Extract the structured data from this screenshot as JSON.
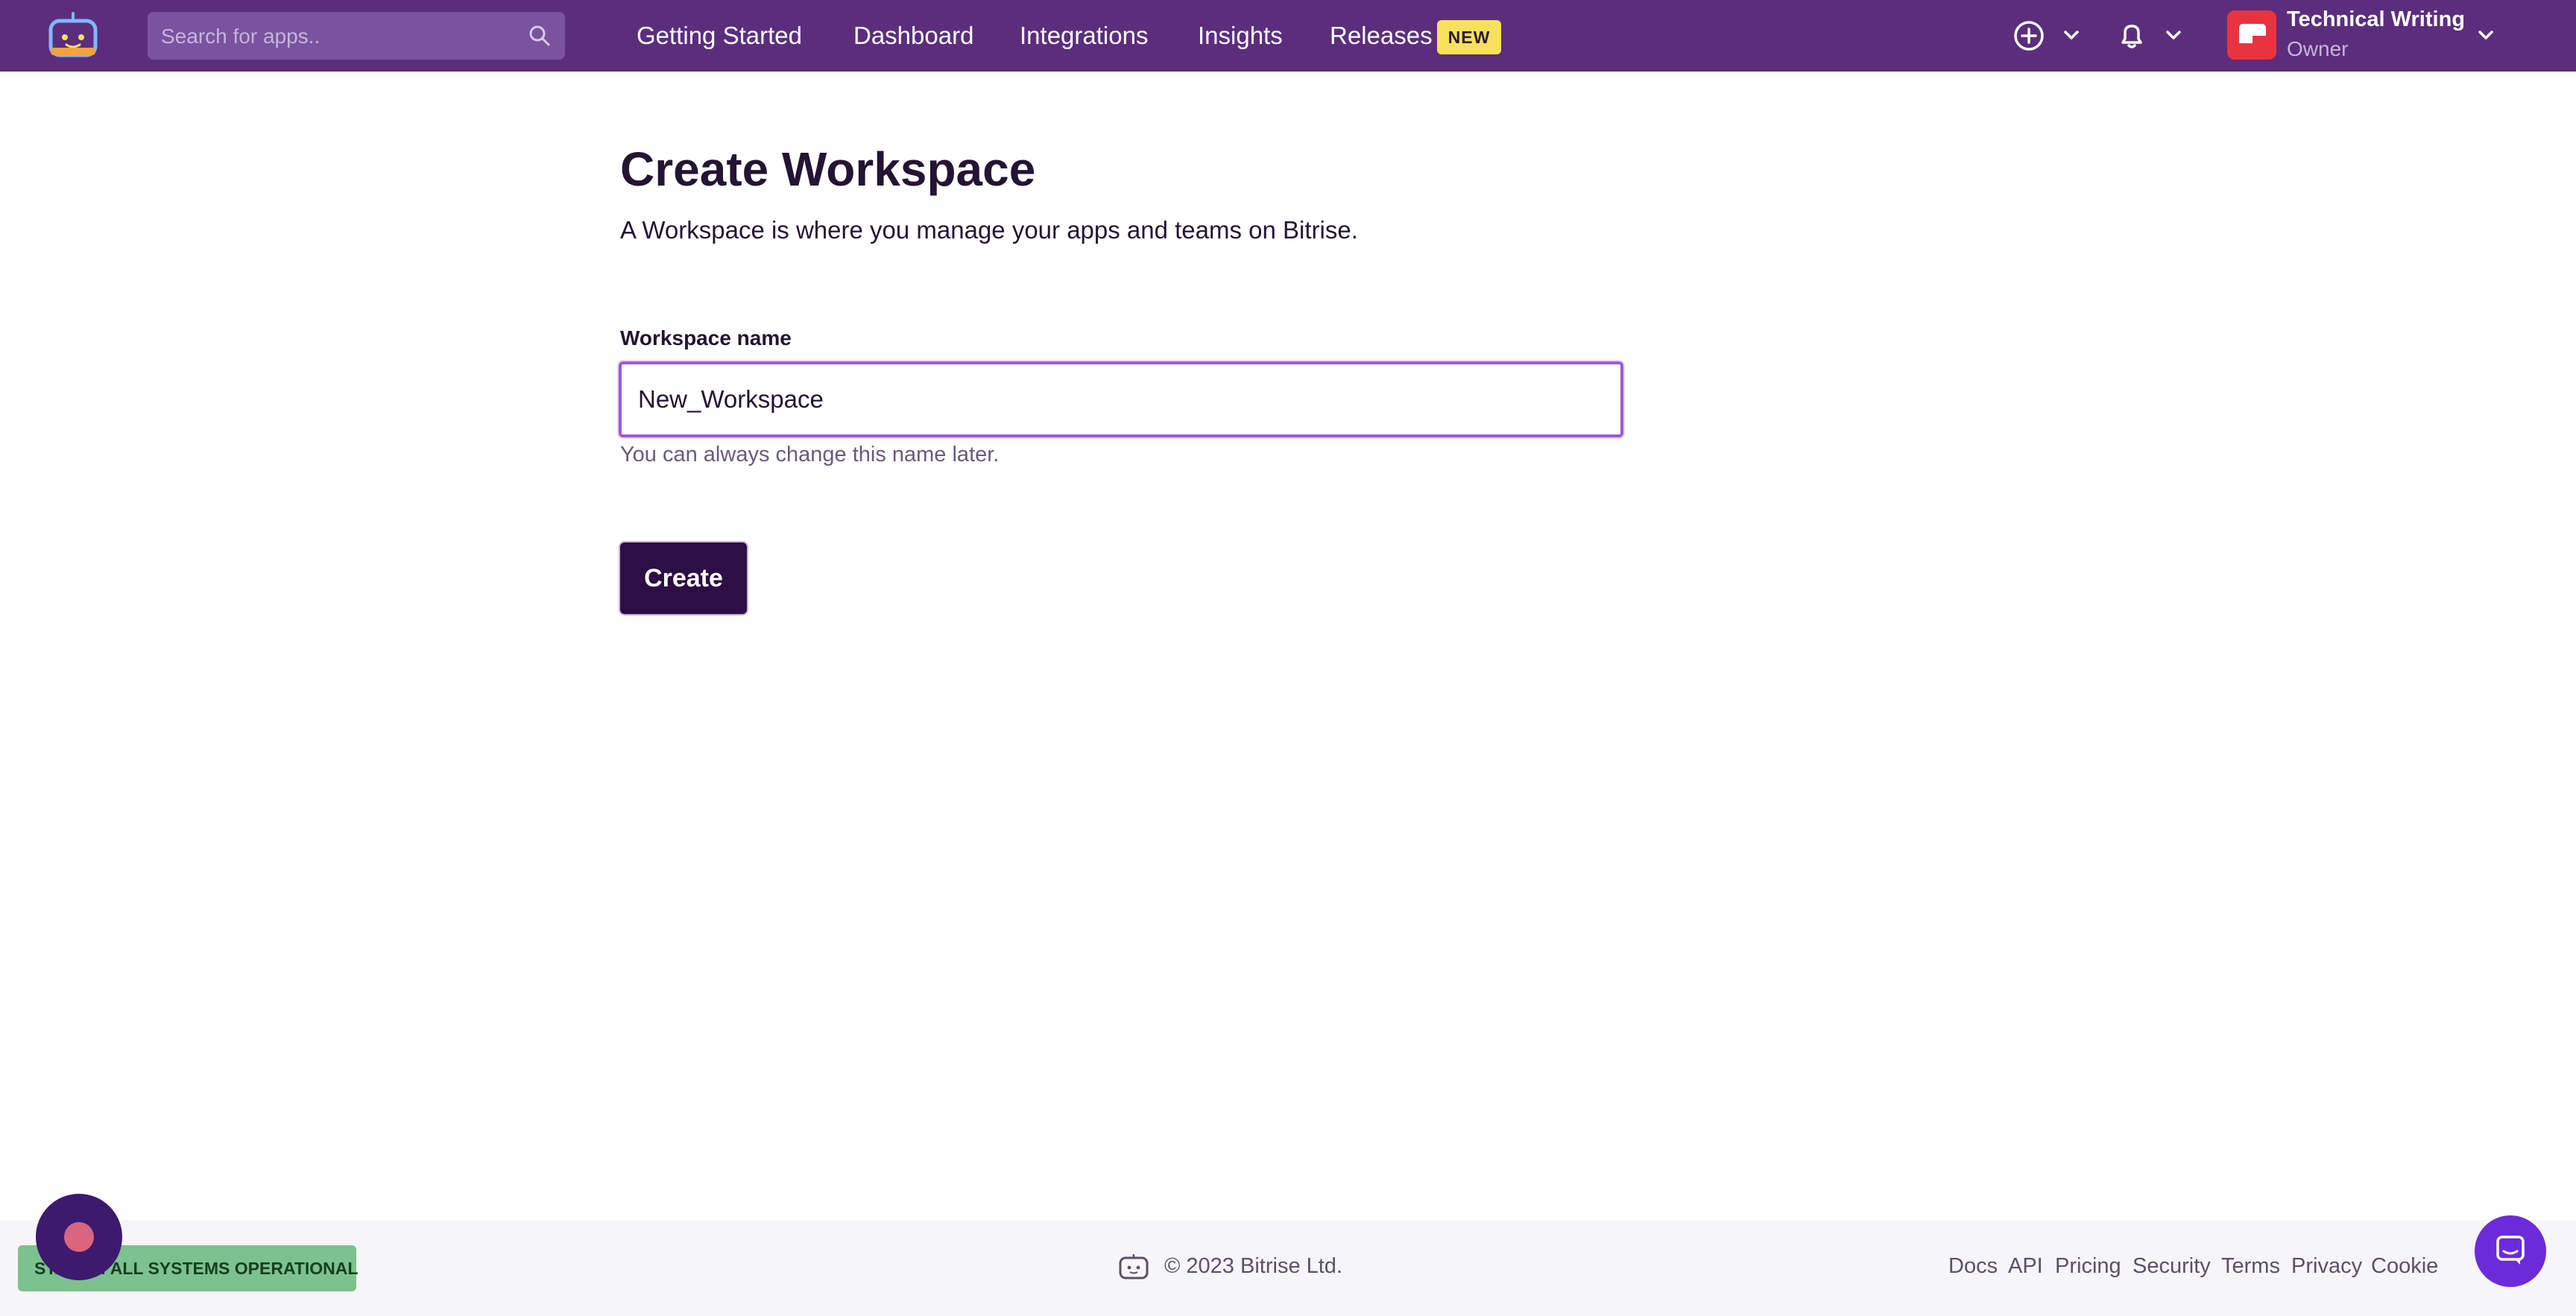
{
  "search": {
    "placeholder": "Search for apps.."
  },
  "nav": {
    "items": [
      {
        "label": "Getting Started"
      },
      {
        "label": "Dashboard"
      },
      {
        "label": "Integrations"
      },
      {
        "label": "Insights"
      },
      {
        "label": "Releases"
      }
    ],
    "releases_badge": "NEW"
  },
  "account": {
    "name": "Technical Writing",
    "role": "Owner"
  },
  "page": {
    "title": "Create Workspace",
    "description": "A Workspace is where you manage your apps and teams on Bitrise."
  },
  "form": {
    "label": "Workspace name",
    "value": "New_Workspace",
    "hint": "You can always change this name later.",
    "submit_label": "Create"
  },
  "footer": {
    "status": "STATUS: ALL SYSTEMS OPERATIONAL",
    "copyright": "© 2023 Bitrise Ltd.",
    "links": [
      "Docs",
      "API",
      "Pricing",
      "Security",
      "Terms",
      "Privacy",
      "Cookie"
    ]
  },
  "colors": {
    "nav_background": "#5c2d7d",
    "primary_button": "#2b0f45",
    "badge_new": "#f7e05b",
    "status_ok": "#7cc28f",
    "avatar": "#e8343f",
    "support": "#6c2bd9"
  },
  "icons": {
    "logo": "bitrise-robot-icon",
    "search": "search-icon",
    "add": "plus-circle-icon",
    "notifications": "bell-icon",
    "dropdown": "chevron-down-icon",
    "support": "chat-icon"
  }
}
